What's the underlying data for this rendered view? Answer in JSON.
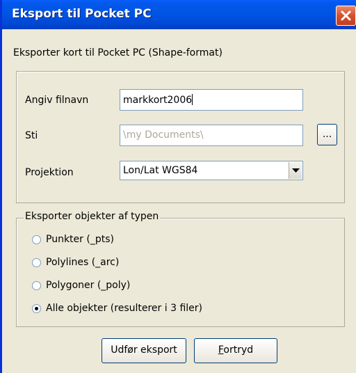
{
  "window": {
    "title": "Eksport til Pocket PC"
  },
  "intro_text": "Eksporter kort til Pocket PC (Shape-format)",
  "fields": {
    "filename_label": "Angiv filnavn",
    "filename_value": "markkort2006",
    "path_label": "Sti",
    "path_value": "\\my Documents\\",
    "browse_label": "...",
    "projection_label": "Projektion",
    "projection_value": "Lon/Lat WGS84"
  },
  "object_types": {
    "legend": "Eksporter objekter af typen",
    "options": [
      {
        "label": "Punkter (_pts)",
        "selected": false
      },
      {
        "label": "Polylines (_arc)",
        "selected": false
      },
      {
        "label": "Polygoner (_poly)",
        "selected": false
      },
      {
        "label": "Alle objekter (resulterer i 3 filer)",
        "selected": true
      }
    ]
  },
  "buttons": {
    "export_label": "Udfør eksport",
    "cancel_first_letter": "F",
    "cancel_rest": "ortryd"
  },
  "icons": {
    "close": "close-icon",
    "dropdown": "chevron-down-icon"
  },
  "colors": {
    "titlebar": "#0055e5",
    "close_button": "#d6502d",
    "face": "#ece9d8"
  }
}
